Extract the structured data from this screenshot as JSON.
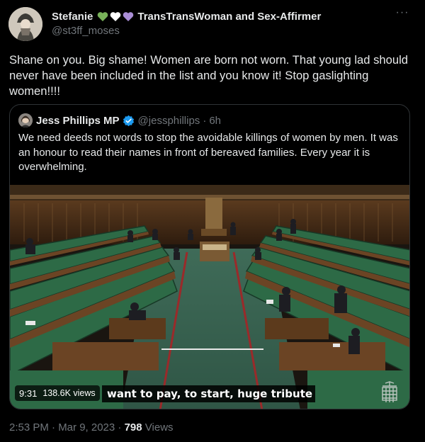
{
  "author": {
    "display_name": "Stefanie",
    "name_suffix": "TransTransWoman and Sex-Affirmer",
    "handle": "@st3ff_moses",
    "heart_colors": [
      "#78b159",
      "#ffffff",
      "#aa8ed6"
    ]
  },
  "more_icon_label": "···",
  "tweet_text": "Shane on you. Big shame! Women are born not worn. That young lad should never have been included in the list and you know it! Stop gaslighting women!!!!",
  "quoted": {
    "name": "Jess Phillips MP",
    "handle": "@jessphillips",
    "separator": "·",
    "age": "6h",
    "text": "We need deeds not words to stop the avoidable killings of women by men. It was an honour to read their names in front of bereaved families. Every year it is overwhelming.",
    "video": {
      "duration": "9:31",
      "views": "138.6K views",
      "caption": "want to pay, to start, huge tribute"
    }
  },
  "footer": {
    "timestamp": "2:53 PM · Mar 9, 2023 ·",
    "views_count": "798",
    "views_label": "Views"
  },
  "colors": {
    "background": "#000000",
    "text_primary": "#e7e9ea",
    "text_secondary": "#71767b",
    "border": "#2f3336",
    "verified": "#1d9bf0",
    "bench_green": "#2d6a46"
  }
}
